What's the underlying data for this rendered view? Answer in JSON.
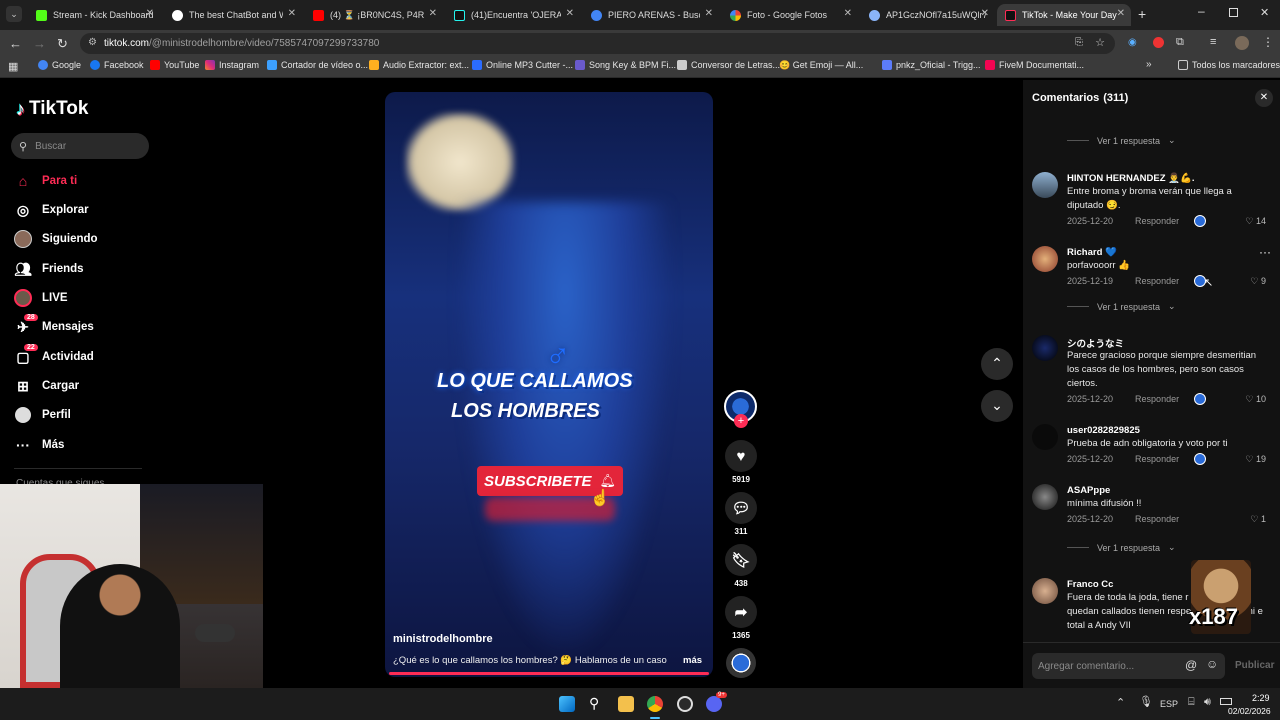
{
  "browser": {
    "tabs": [
      {
        "title": "Stream - Kick Dashboard",
        "color": "#53fc18"
      },
      {
        "title": "The best ChatBot and Wi",
        "color": "#ffffff"
      },
      {
        "title": "(4) ⏳ ¡BR0NC4S, P4R",
        "color": "#ff0000"
      },
      {
        "title": "(41)Encuentra 'OJERAS AI",
        "color": "#25f4ee"
      },
      {
        "title": "PIERO ARENAS - Buscar c",
        "color": "#4285f4"
      },
      {
        "title": "Foto - Google Fotos",
        "color": "#fbbc04"
      },
      {
        "title": "AP1GczNOfl7a15uWQlr7",
        "color": "#8ab4f8"
      },
      {
        "title": "TikTok - Make Your Day",
        "color": "#ffffff"
      }
    ],
    "url_host": "tiktok.com",
    "url_path": "/@ministrodelhombre/video/7585747097299733780",
    "bookmarks": [
      "Google",
      "Facebook",
      "YouTube",
      "Instagram",
      "Cortador de vídeo o...",
      "Audio Extractor: ext...",
      "Online MP3 Cutter -...",
      "Song Key & BPM Fi...",
      "Conversor de Letras...",
      "😊 Get Emoji — All...",
      "pnkz_Oficial - Trigg...",
      "FiveM Documentati..."
    ],
    "all_bookmarks": "Todos los marcadores"
  },
  "sidebar": {
    "logo": "TikTok",
    "search_placeholder": "Buscar",
    "items": [
      {
        "label": "Para ti"
      },
      {
        "label": "Explorar"
      },
      {
        "label": "Siguiendo"
      },
      {
        "label": "Friends"
      },
      {
        "label": "LIVE"
      },
      {
        "label": "Mensajes",
        "badge": "28"
      },
      {
        "label": "Actividad",
        "badge": "22"
      },
      {
        "label": "Cargar"
      },
      {
        "label": "Perfil"
      },
      {
        "label": "Más"
      }
    ],
    "following_heading": "Cuentas que sigues"
  },
  "video": {
    "overlay_line1": "LO QUE CALLAMOS",
    "overlay_line2": "LOS HOMBRES",
    "subscribe": "SUBSCRIBETE",
    "author": "ministrodelhombre",
    "caption": "¿Qué es lo que callamos los hombres? 🤔 Hablamos de un caso",
    "more": "más",
    "likes": "5919",
    "comments": "311",
    "saves": "438",
    "shares": "1365"
  },
  "comments_panel": {
    "title": "Comentarios",
    "count": "(311)",
    "view_replies": "Ver 1 respuesta",
    "reply_label": "Responder",
    "input_placeholder": "Agregar comentario...",
    "publish": "Publicar",
    "items": [
      {
        "name": "HINTON HERNANDEZ 👨‍⚕️💪.",
        "text": "Entre broma y broma verán que llega a diputado 😏.",
        "date": "2025-12-20",
        "likes": "14"
      },
      {
        "name": "Richard 💙",
        "text": "porfavooorr 👍",
        "date": "2025-12-19",
        "likes": "9"
      },
      {
        "name": "シのようなミ",
        "text": "Parece gracioso porque siempre desmeritian los casos de los hombres, pero son casos ciertos.",
        "date": "2025-12-20",
        "likes": "10"
      },
      {
        "name": "user0282829825",
        "text": "Prueba de adn obligatoria y voto por ti",
        "date": "2025-12-20",
        "likes": "19"
      },
      {
        "name": "ASAPppe",
        "text": "mínima difusión !!",
        "date": "2025-12-20",
        "likes": "1"
      },
      {
        "name": "Franco Cc",
        "text": "Fuera de toda la joda, tiene r hombres se quedan callados tienen respeto ni en casa ni e total a Andy VII",
        "date": "",
        "likes": ""
      }
    ],
    "sticker_text": "x187"
  },
  "taskbar": {
    "lang": "ESP",
    "time": "2:29",
    "date": "02/02/2026",
    "discord_badge": "9+"
  }
}
